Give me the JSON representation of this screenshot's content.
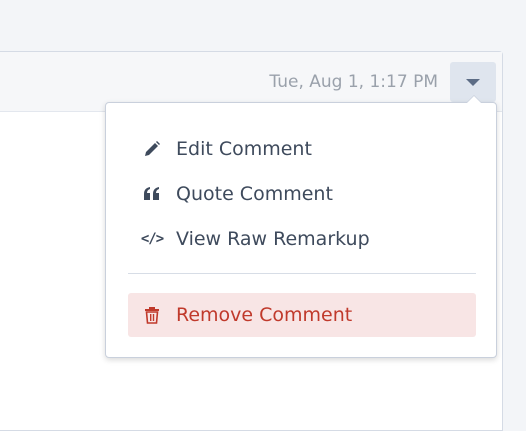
{
  "comment": {
    "timestamp": "Tue, Aug 1, 1:17 PM"
  },
  "menu": {
    "items": [
      {
        "label": "Edit Comment",
        "icon": "pencil-icon"
      },
      {
        "label": "Quote Comment",
        "icon": "quote-icon"
      },
      {
        "label": "View Raw Remarkup",
        "icon": "code-icon"
      }
    ],
    "danger_item": {
      "label": "Remove Comment",
      "icon": "trash-icon"
    }
  },
  "colors": {
    "danger_text": "#c0392b",
    "danger_background": "#f8e5e5",
    "menu_text": "#3e4a5c",
    "timestamp_text": "#9aa1ab"
  }
}
